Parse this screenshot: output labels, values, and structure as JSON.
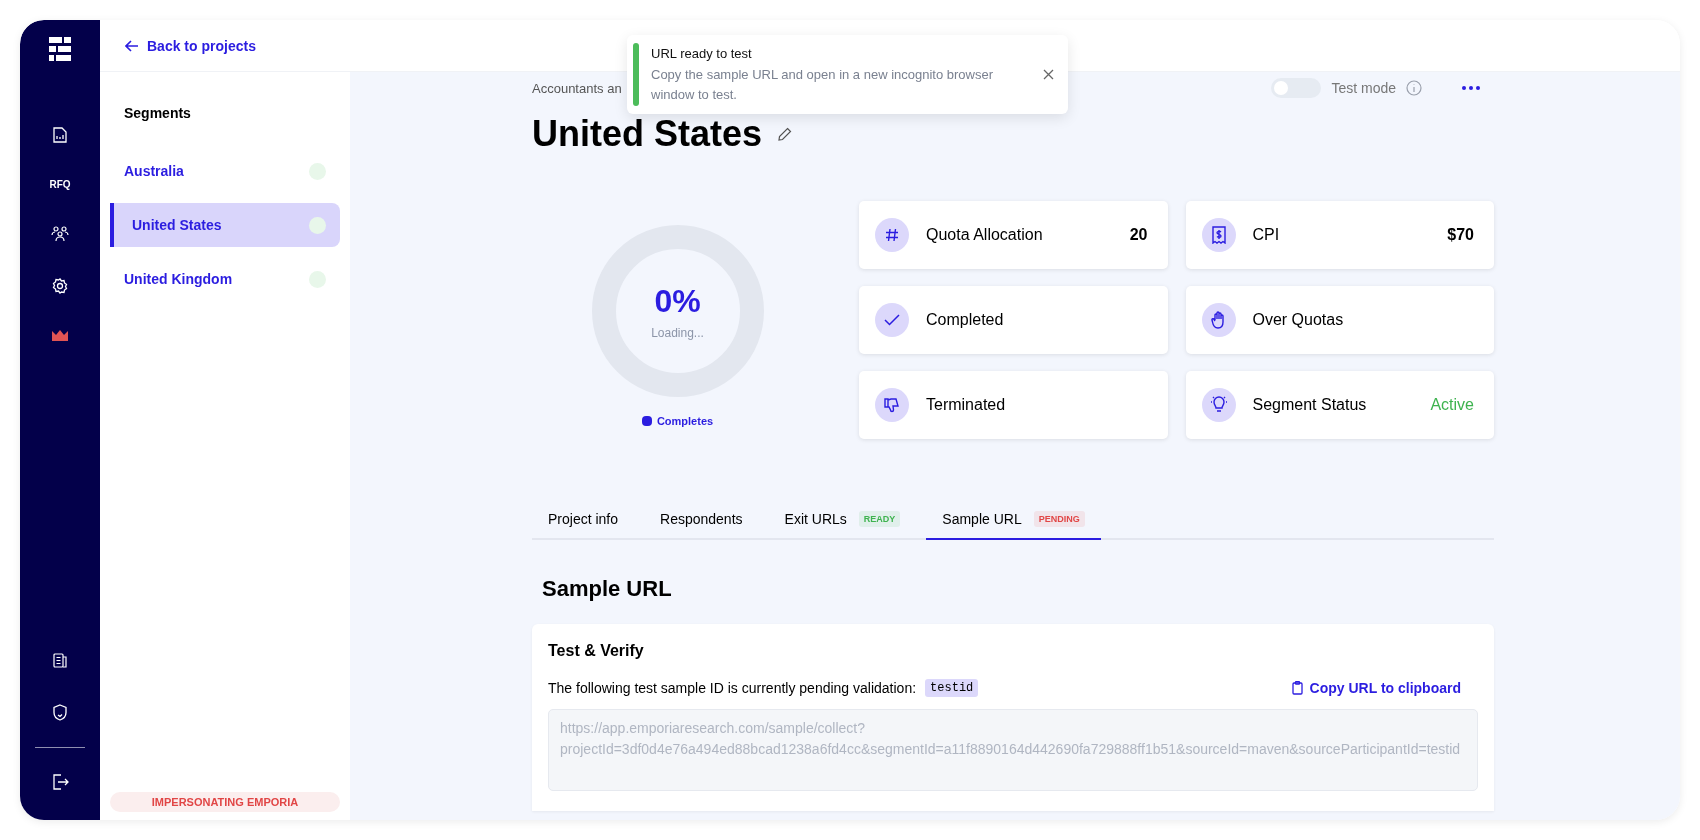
{
  "nav": {
    "label": "RFQ"
  },
  "header": {
    "back_link": "Back to projects"
  },
  "sidebar": {
    "title": "Segments",
    "items": [
      {
        "name": "Australia",
        "selected": false
      },
      {
        "name": "United States",
        "selected": true
      },
      {
        "name": "United Kingdom",
        "selected": false
      }
    ],
    "footer_badge": "IMPERSONATING EMPORIA"
  },
  "toast": {
    "title": "URL ready to test",
    "message": "Copy the sample URL and open in a new incognito browser window to test."
  },
  "breadcrumb": "Accountants an",
  "test_mode": {
    "label": "Test mode",
    "on": false
  },
  "title": "United States",
  "progress": {
    "percent": "0%",
    "status": "Loading...",
    "legend": "Completes"
  },
  "stats": [
    {
      "label": "Quota Allocation",
      "value": "20",
      "bold": true
    },
    {
      "label": "CPI",
      "value": "$70",
      "bold": true
    },
    {
      "label": "Completed"
    },
    {
      "label": "Over Quotas"
    },
    {
      "label": "Terminated"
    },
    {
      "label": "Segment Status",
      "value": "Active",
      "bold": false,
      "color": "#3eb34f"
    }
  ],
  "tabs": [
    {
      "label": "Project info",
      "selected": false
    },
    {
      "label": "Respondents",
      "selected": false
    },
    {
      "label": "Exit URLs",
      "selected": false,
      "badge": {
        "text": "READY",
        "color": "#3eb34f"
      }
    },
    {
      "label": "Sample URL",
      "selected": true,
      "badge": {
        "text": "PENDING",
        "color": "#e14646"
      }
    }
  ],
  "section": {
    "heading": "Sample URL",
    "card_title": "Test & Verify",
    "message": "The following test sample ID is currently pending validation:",
    "sample_id": "testid",
    "copy_link": "Copy URL to clipboard",
    "url": "https://app.emporiaresearch.com/sample/collect?\nprojectId=3df0d4e76a494ed88bcad1238a6fd4cc&segmentId=a11f8890164d442690fa729888ff1b51&sourceId=maven&sourceParticipantId=testid"
  }
}
